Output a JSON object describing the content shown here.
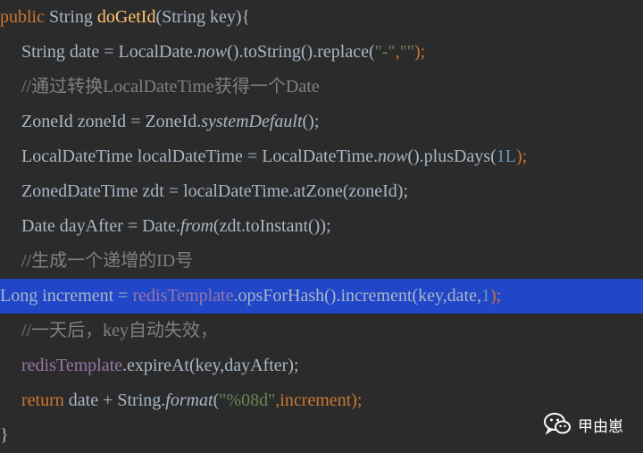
{
  "code": {
    "l1": [
      "public ",
      "String ",
      "doGetId",
      "(String key){"
    ],
    "l2": [
      "String date = LocalDate.",
      "now",
      "().toString().replace(",
      "\"-\"",
      ",",
      "\"\"",
      ");"
    ],
    "l3": [
      "//通过转换LocalDateTime获得一个Date"
    ],
    "l4": [
      "ZoneId zoneId = ZoneId.",
      "systemDefault",
      "();"
    ],
    "l5": [
      "LocalDateTime localDateTime = LocalDateTime.",
      "now",
      "().plusDays(",
      "1L",
      ");"
    ],
    "l6": [
      "ZonedDateTime zdt = localDateTime.atZone(zoneId);"
    ],
    "l7": [
      "Date dayAfter = Date.",
      "from",
      "(zdt.toInstant());"
    ],
    "l8": [
      "//生成一个递增的ID号"
    ],
    "l9": [
      "Long increment = ",
      "redisTemplate",
      ".opsForHash().increment(key,date,",
      "1",
      ");"
    ],
    "l10": [
      "//一天后，key自动失效，"
    ],
    "l11": [
      "redisTemplate",
      ".expireAt(key,dayAfter);"
    ],
    "l12": [
      "return ",
      "date + String.",
      "format",
      "(",
      "\"%08d\"",
      ",increment);"
    ],
    "l13": [
      "}"
    ]
  },
  "watermark": {
    "text": "甲由崽",
    "icon": "wechat-icon"
  },
  "colors": {
    "background": "#2b2b2b",
    "keyword": "#cc7832",
    "method": "#ffc66d",
    "string": "#6a8759",
    "number": "#6897bb",
    "field": "#9876aa",
    "comment": "#808080",
    "selection": "#2146c7"
  }
}
